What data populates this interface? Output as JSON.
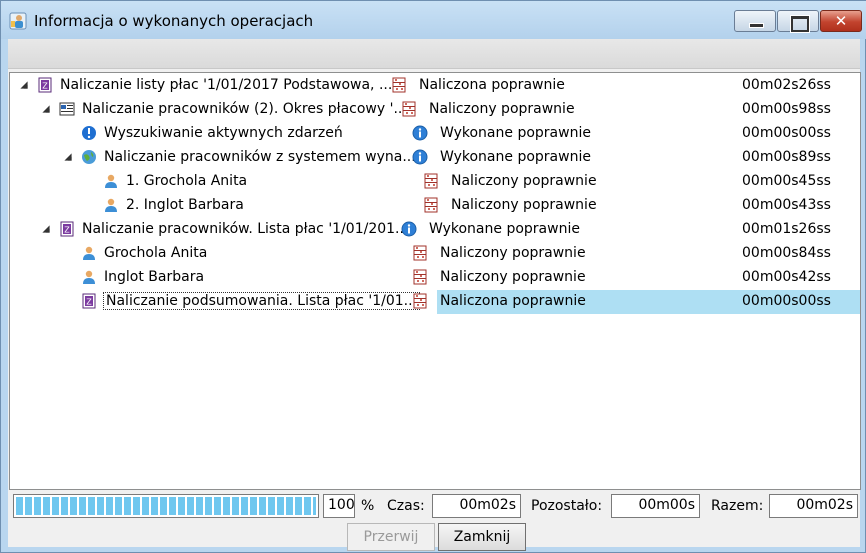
{
  "window": {
    "title": "Informacja o wykonanych operacjach"
  },
  "tree": {
    "rows": [
      {
        "level": 0,
        "expanded": true,
        "icon": "list-doc-icon",
        "name": "Naliczanie listy płac '1/01/2017  Podstawowa, ...",
        "status_icon": "abacus-icon",
        "status": "Naliczona poprawnie",
        "time": "00m02s26ss"
      },
      {
        "level": 1,
        "expanded": true,
        "icon": "employees-list-icon",
        "name": "Naliczanie pracowników (2). Okres płacowy '...",
        "status_icon": "abacus-icon",
        "status": "Naliczony poprawnie",
        "time": "00m00s98ss"
      },
      {
        "level": 2,
        "expanded": null,
        "icon": "info-blue-icon",
        "name": "Wyszukiwanie aktywnych zdarzeń",
        "status_icon": "info-icon",
        "status": "Wykonane poprawnie",
        "time": "00m00s00ss"
      },
      {
        "level": 2,
        "expanded": true,
        "icon": "globe-icon",
        "name": "Naliczanie pracowników z systemem wyna...",
        "status_icon": "info-icon",
        "status": "Wykonane poprawnie",
        "time": "00m00s89ss"
      },
      {
        "level": 3,
        "expanded": null,
        "icon": "person-icon",
        "name": "1. Grochola Anita",
        "status_icon": "abacus-icon",
        "status": "Naliczony poprawnie",
        "time": "00m00s45ss"
      },
      {
        "level": 3,
        "expanded": null,
        "icon": "person-icon",
        "name": "2. Inglot Barbara",
        "status_icon": "abacus-icon",
        "status": "Naliczony poprawnie",
        "time": "00m00s43ss"
      },
      {
        "level": 1,
        "expanded": true,
        "icon": "list-doc-icon",
        "name": "Naliczanie pracowników. Lista płac '1/01/201...",
        "status_icon": "info-icon",
        "status": "Wykonane poprawnie",
        "time": "00m01s26ss"
      },
      {
        "level": 2,
        "expanded": null,
        "icon": "person-icon",
        "name": "Grochola Anita",
        "status_icon": "abacus-icon",
        "status": "Naliczony poprawnie",
        "time": "00m00s84ss"
      },
      {
        "level": 2,
        "expanded": null,
        "icon": "person-icon",
        "name": "Inglot Barbara",
        "status_icon": "abacus-icon",
        "status": "Naliczony poprawnie",
        "time": "00m00s42ss"
      },
      {
        "level": 2,
        "expanded": null,
        "icon": "list-doc-icon",
        "name": "Naliczanie podsumowania. Lista płac '1/01...",
        "status_icon": "abacus-icon",
        "status": "Naliczona poprawnie",
        "time": "00m00s00ss",
        "selected": true
      }
    ]
  },
  "footer": {
    "progress_percent": 100,
    "progress_value": "100",
    "percent_sign": "%",
    "czas_label": "Czas:",
    "czas_value": "00m02s",
    "pozostalo_label": "Pozostało:",
    "pozostalo_value": "00m00s",
    "razem_label": "Razem:",
    "razem_value": "00m02s",
    "przerwij_label": "Przerwij",
    "zamknij_label": "Zamknij"
  },
  "colors": {
    "selection": "#aedff3",
    "progress": "#6ec7ef",
    "titlebar": "#b9d6ef"
  }
}
